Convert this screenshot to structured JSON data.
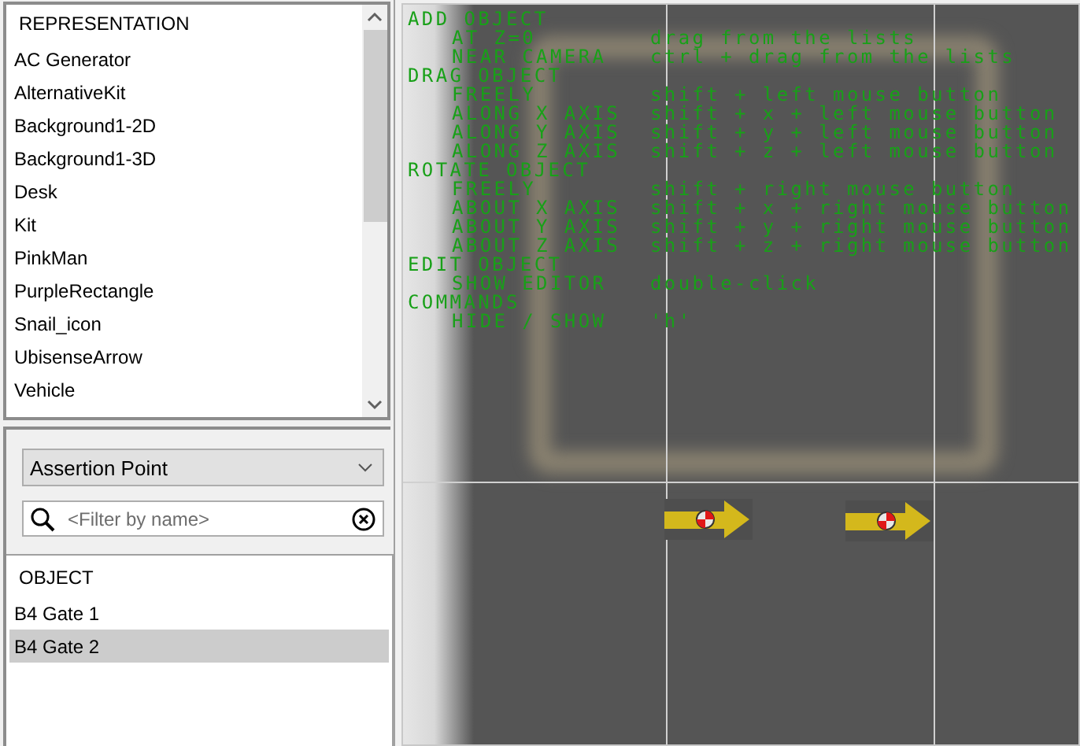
{
  "representation_list": {
    "header": "REPRESENTATION",
    "items": [
      {
        "label": "AC Generator",
        "selected": false
      },
      {
        "label": "AlternativeKit",
        "selected": false
      },
      {
        "label": "Background1-2D",
        "selected": false
      },
      {
        "label": "Background1-3D",
        "selected": false
      },
      {
        "label": "Desk",
        "selected": false
      },
      {
        "label": "Kit",
        "selected": false
      },
      {
        "label": "PinkMan",
        "selected": false
      },
      {
        "label": "PurpleRectangle",
        "selected": false
      },
      {
        "label": "Snail_icon",
        "selected": false
      },
      {
        "label": "UbisenseArrow",
        "selected": false
      },
      {
        "label": "Vehicle",
        "selected": false
      }
    ]
  },
  "type_dropdown": {
    "value": "Assertion Point"
  },
  "filter": {
    "placeholder": "<Filter by name>"
  },
  "object_list": {
    "header": "OBJECT",
    "items": [
      {
        "label": "B4 Gate 1",
        "selected": false
      },
      {
        "label": "B4 Gate 2",
        "selected": true
      }
    ]
  },
  "help_overlay": {
    "sections": [
      {
        "title": "ADD OBJECT",
        "commands": [
          {
            "action": "AT Z=0",
            "keys": "drag from the lists"
          },
          {
            "action": "NEAR CAMERA",
            "keys": "ctrl + drag from the lists"
          }
        ]
      },
      {
        "title": "DRAG OBJECT",
        "commands": [
          {
            "action": "FREELY",
            "keys": "shift + left mouse button"
          },
          {
            "action": "ALONG X AXIS",
            "keys": "shift + x + left mouse button"
          },
          {
            "action": "ALONG Y AXIS",
            "keys": "shift + y + left mouse button"
          },
          {
            "action": "ALONG Z AXIS",
            "keys": "shift + z + left mouse button"
          }
        ]
      },
      {
        "title": "ROTATE OBJECT",
        "commands": [
          {
            "action": "FREELY",
            "keys": "shift + right mouse button"
          },
          {
            "action": "ABOUT X AXIS",
            "keys": "shift + x + right mouse button"
          },
          {
            "action": "ABOUT Y AXIS",
            "keys": "shift + y + right mouse button"
          },
          {
            "action": "ABOUT Z AXIS",
            "keys": "shift + z + right mouse button"
          }
        ]
      },
      {
        "title": "EDIT OBJECT",
        "commands": [
          {
            "action": "SHOW EDITOR",
            "keys": "double-click"
          }
        ]
      },
      {
        "title": "COMMANDS",
        "commands": [
          {
            "action": "HIDE / SHOW",
            "keys": "'h'"
          }
        ]
      }
    ]
  }
}
